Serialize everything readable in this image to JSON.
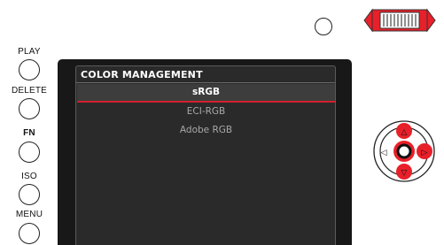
{
  "camera": {
    "side_buttons": [
      {
        "label": "PLAY"
      },
      {
        "label": "DELETE"
      },
      {
        "label": "FN"
      },
      {
        "label": "ISO"
      },
      {
        "label": "MENU"
      }
    ]
  },
  "screen": {
    "title": "COLOR MANAGEMENT",
    "options": [
      {
        "label": "sRGB",
        "selected": true
      },
      {
        "label": "ECI-RGB",
        "selected": false
      },
      {
        "label": "Adobe RGB",
        "selected": false
      }
    ],
    "selection_color": "#d2202b"
  },
  "dpad": {
    "arrows": {
      "up": "△",
      "down": "▽",
      "left": "◁",
      "right": "▷"
    },
    "highlight_color": "#e8202a"
  },
  "colors": {
    "screen_bg": "#181818",
    "panel_bg": "#2a2a2a",
    "accent": "#d2202b"
  },
  "icons": [
    "thumbwheel-icon",
    "dpad-icon"
  ]
}
